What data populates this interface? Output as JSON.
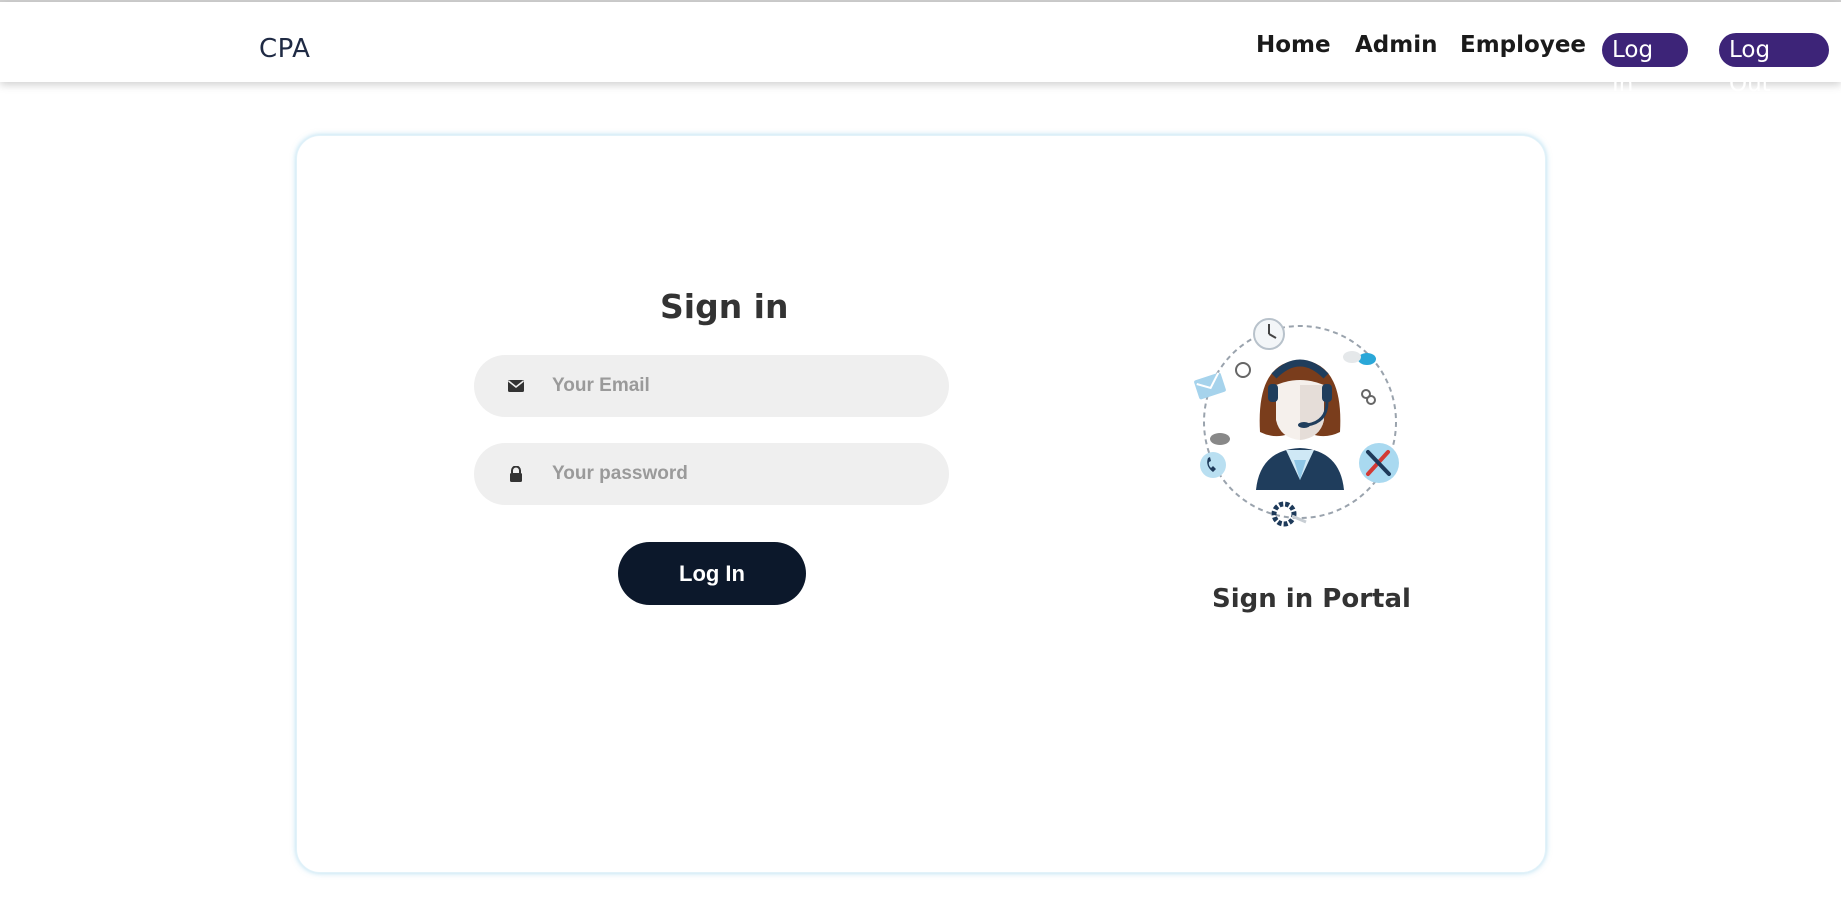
{
  "navbar": {
    "brand": "CPA",
    "links": [
      "Home",
      "Admin",
      "Employee"
    ],
    "login_label": "Log In",
    "logout_label": "Log Out",
    "accent_color": "#3d2478"
  },
  "form": {
    "title": "Sign in",
    "email": {
      "placeholder": "Your Email",
      "value": "",
      "icon": "envelope-icon"
    },
    "password": {
      "placeholder": "Your password",
      "value": "",
      "icon": "lock-icon"
    },
    "submit_label": "Log In",
    "button_color": "#0c182b"
  },
  "portal": {
    "caption": "Sign in Portal",
    "image": "customer-support-agent-illustration"
  }
}
